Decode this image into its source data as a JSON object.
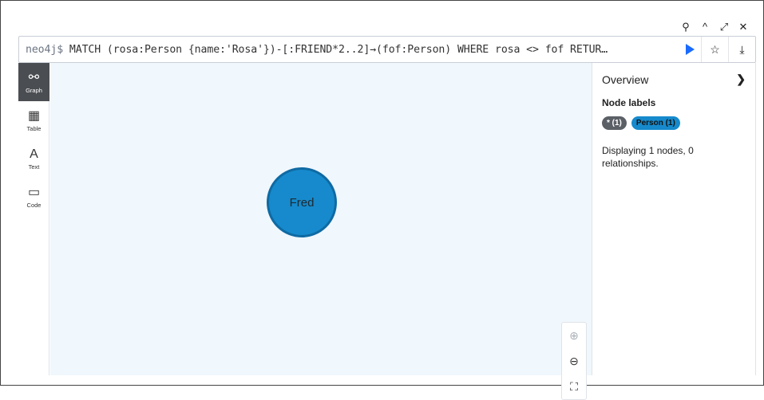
{
  "window_controls": {
    "pin": "⚲",
    "collapse": "^",
    "expand": "⤢",
    "close": "✕"
  },
  "query": {
    "prompt": "neo4j$",
    "text": "MATCH (rosa:Person {name:'Rosa'})-[:FRIEND*2..2]→(fof:Person) WHERE rosa <> fof RETUR…"
  },
  "query_actions": {
    "favorite": "☆",
    "download": "⤓"
  },
  "sidebar": {
    "items": [
      {
        "label": "Graph",
        "icon": "graph-icon",
        "glyph": "⚯"
      },
      {
        "label": "Table",
        "icon": "table-icon",
        "glyph": "▦"
      },
      {
        "label": "Text",
        "icon": "text-icon",
        "glyph": "A"
      },
      {
        "label": "Code",
        "icon": "code-icon",
        "glyph": "▭"
      }
    ]
  },
  "graph": {
    "nodes": [
      {
        "caption": "Fred",
        "label": "Person",
        "color": "#168acc"
      }
    ]
  },
  "zoom": {
    "in": "⊕",
    "out": "⊖",
    "fit": "⛶"
  },
  "overview": {
    "title": "Overview",
    "node_labels_heading": "Node labels",
    "chips": [
      {
        "text": "* (1)"
      },
      {
        "text": "Person (1)"
      }
    ],
    "summary": "Displaying 1 nodes, 0 relationships."
  },
  "colors": {
    "accent": "#1a6aff",
    "node": "#168acc",
    "canvas": "#f0f7fd"
  }
}
